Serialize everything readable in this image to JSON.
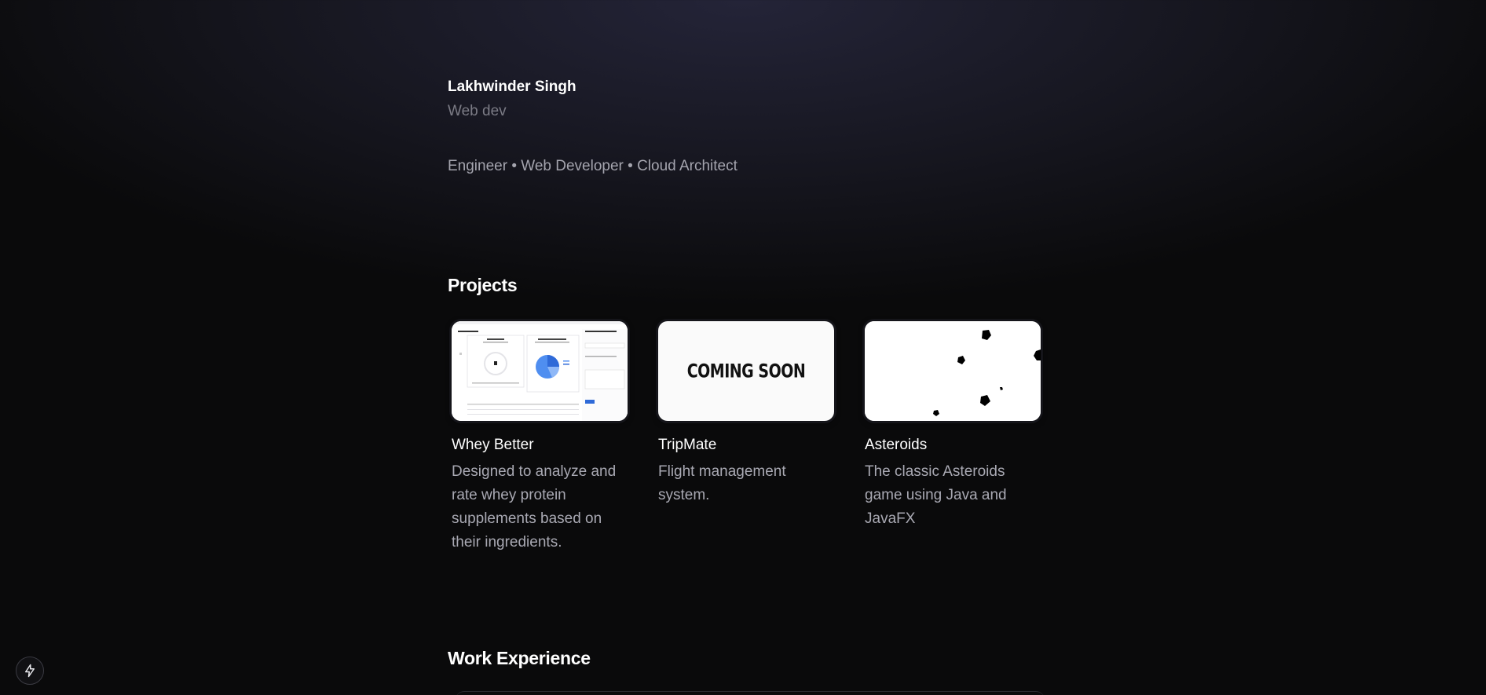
{
  "profile": {
    "name": "Lakhwinder Singh",
    "role": "Web dev",
    "tagline": "Engineer • Web Developer • Cloud Architect"
  },
  "projects": {
    "title": "Projects",
    "items": [
      {
        "title": "Whey Better",
        "description": "Designed to analyze and rate whey protein supplements based on their ingredients.",
        "thumbnail": "dashboard-screenshot"
      },
      {
        "title": "TripMate",
        "description": "Flight management system.",
        "thumbnail_text": "COMING SOON"
      },
      {
        "title": "Asteroids",
        "description": "The classic Asteroids game using Java and JavaFX",
        "thumbnail": "asteroids-game-screenshot"
      }
    ]
  },
  "work": {
    "title": "Work Experience"
  },
  "floating_button": {
    "icon": "lightning-bolt-icon"
  }
}
